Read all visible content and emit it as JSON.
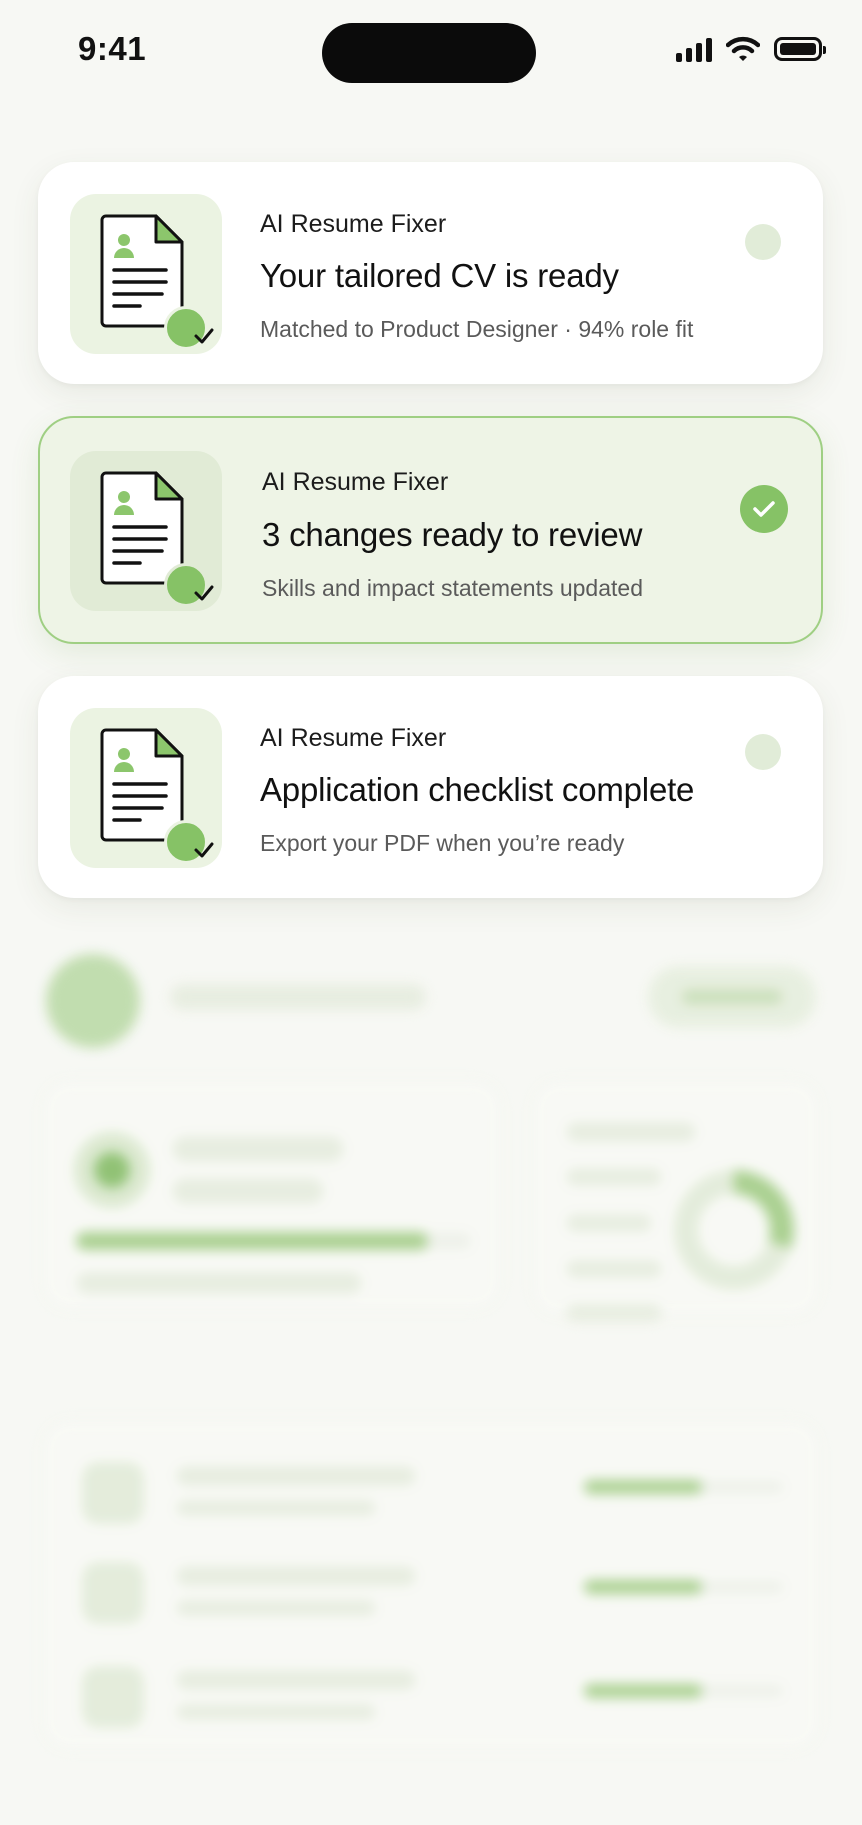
{
  "status_bar": {
    "time": "9:41",
    "icons": [
      "cellular-signal-icon",
      "wifi-icon",
      "battery-icon"
    ]
  },
  "notifications": [
    {
      "app_name": "AI Resume Fixer",
      "title": "Your tailored CV is ready",
      "subtitle": "Matched to Product Designer · 94% role fit",
      "state": "unread"
    },
    {
      "app_name": "AI Resume Fixer",
      "title": "3 changes ready to review",
      "subtitle": "Skills and impact statements updated",
      "state": "selected"
    },
    {
      "app_name": "AI Resume Fixer",
      "title": "Application checklist complete",
      "subtitle": "Export your PDF when you’re ready",
      "state": "unread"
    }
  ],
  "colors": {
    "accent_green": "#86c266",
    "selected_card_bg": "#eef4e6",
    "selected_card_border": "#9fcf83",
    "page_bg": "#f7f8f4"
  },
  "icon_names": {
    "app_icon": "resume-document-icon",
    "badge": "checkmark-icon",
    "unread_indicator": "unread-dot",
    "read_indicator": "checkmark-circle-icon"
  }
}
